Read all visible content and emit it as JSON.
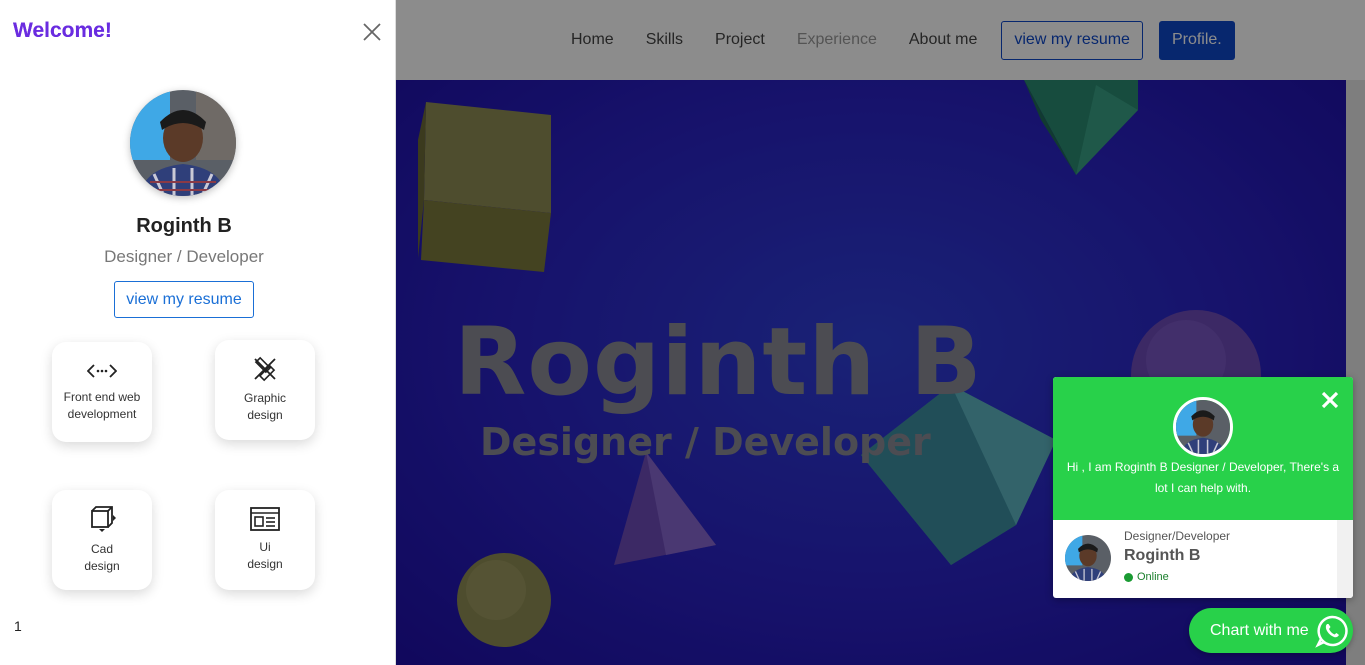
{
  "navbar": {
    "links": [
      "Home",
      "Skills",
      "Project",
      "Experience",
      "About me"
    ],
    "resume_label": "view my resume",
    "profile_label": "Profile."
  },
  "hero": {
    "name": "Roginth B",
    "role": "Designer / Developer"
  },
  "offcanvas": {
    "title": "Welcome!",
    "name": "Roginth B",
    "role": "Designer / Developer",
    "resume_label": "view my resume",
    "skills": [
      {
        "line1": "Front end web",
        "line2": "development",
        "icon": "code-icon"
      },
      {
        "line1": "Graphic",
        "line2": "design",
        "icon": "pen-tool-icon"
      },
      {
        "line1": "Cad",
        "line2": "design",
        "icon": "box-icon"
      },
      {
        "line1": "Ui",
        "line2": "design",
        "icon": "layout-icon"
      }
    ],
    "footer": "1"
  },
  "chat": {
    "message": "Hi , I am Roginth B Designer / Developer, There's a lot I can help with.",
    "role": "Designer/Developer",
    "name": "Roginth B",
    "status": "Online",
    "cta": "Chart with me"
  },
  "colors": {
    "brand_blue": "#0d47c9",
    "whatsapp_green": "#28d14a",
    "welcome_purple": "#6a2ce0"
  }
}
